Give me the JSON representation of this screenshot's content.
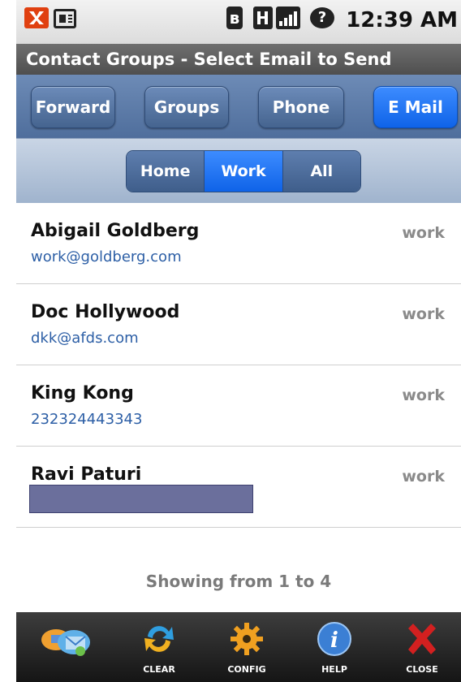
{
  "status_bar": {
    "bluetooth_symbol": "ʙ",
    "question_symbol": "?",
    "time": "12:39 AM"
  },
  "title": "Contact Groups - Select Email to Send",
  "top_nav": {
    "buttons": [
      "Forward",
      "Groups",
      "Phone",
      "E Mail"
    ],
    "active": "E Mail"
  },
  "segments": {
    "items": [
      "Home",
      "Work",
      "All"
    ],
    "active": "Work"
  },
  "contacts": [
    {
      "name": "Abigail Goldberg",
      "detail": "work@goldberg.com",
      "type": "work"
    },
    {
      "name": "Doc Hollywood",
      "detail": "dkk@afds.com",
      "type": "work"
    },
    {
      "name": "King Kong",
      "detail": "232324443343",
      "type": "work"
    },
    {
      "name": "Ravi Paturi",
      "detail": "",
      "type": "work"
    }
  ],
  "showing_text": "Showing from 1 to 4",
  "toolbar": {
    "items": [
      {
        "label": "",
        "icon": "contacts-app-icon"
      },
      {
        "label": "CLEAR",
        "icon": "refresh-icon"
      },
      {
        "label": "CONFIG",
        "icon": "gear-icon"
      },
      {
        "label": "HELP",
        "icon": "info-icon"
      },
      {
        "label": "CLOSE",
        "icon": "close-icon"
      }
    ]
  },
  "colors": {
    "active_blue": "#1a6cf0",
    "nav_blue": "#5a78a6",
    "email_link": "#2d5fa6"
  }
}
